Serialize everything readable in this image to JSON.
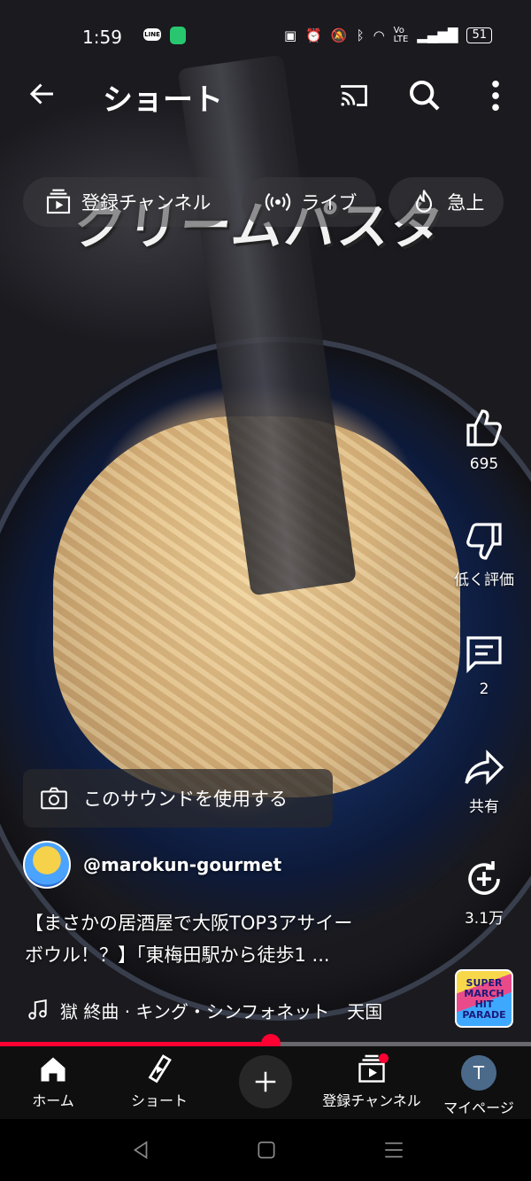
{
  "status_bar": {
    "time": "1:59",
    "line_app": "LINE",
    "battery": "51"
  },
  "topbar": {
    "title": "ショート"
  },
  "chips": [
    {
      "label": "登録チャンネル",
      "icon": "subscriptions-icon"
    },
    {
      "label": "ライブ",
      "icon": "live-icon"
    },
    {
      "label": "急上",
      "icon": "trending-icon"
    }
  ],
  "video": {
    "overlay_title": "クリームパスタ"
  },
  "actions": {
    "like_count": "695",
    "dislike_label": "低く評価",
    "comment_count": "2",
    "share_label": "共有",
    "remix_count": "3.1万"
  },
  "sound": {
    "label": "このサウンドを使用する"
  },
  "channel": {
    "handle": "@marokun-gourmet"
  },
  "description": {
    "line1": "【まさかの居酒屋で大阪TOP3アサイー",
    "line2": "ボウル！？】「東梅田駅から徒歩1 ..."
  },
  "music": {
    "text": "獄 終曲 · キング・シンフォネット　天国",
    "thumb_text": "SUPER MARCH HIT PARADE"
  },
  "progress": {
    "fraction": 0.51
  },
  "bottom_nav": {
    "home": "ホーム",
    "shorts": "ショート",
    "subscriptions": "登録チャンネル",
    "mypage": "マイページ",
    "avatar_letter": "T"
  },
  "colors": {
    "accent": "#ff0033",
    "nav_bg": "#0f0f0f"
  }
}
